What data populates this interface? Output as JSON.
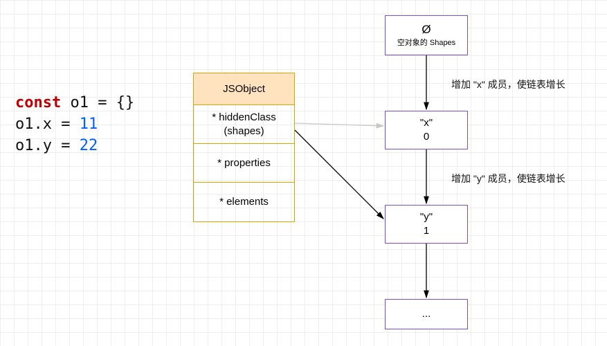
{
  "code": {
    "line1_kw": "const",
    "line1_rest": " o1 = {}",
    "line2_pre": "o1.x = ",
    "line2_num": "11",
    "line3_pre": "o1.y = ",
    "line3_num": "22"
  },
  "jsobject": {
    "header": "JSObject",
    "hiddenClass_l1": "* hiddenClass",
    "hiddenClass_l2": "(shapes)",
    "properties": "* properties",
    "elements": "* elements"
  },
  "shapes": {
    "empty_symbol": "Ø",
    "empty_caption": "空对象的 Shapes",
    "x_label": "\"x\"",
    "x_index": "0",
    "y_label": "\"y\"",
    "y_index": "1",
    "dots": "..."
  },
  "annotations": {
    "add_x": "增加 \"x\" 成员，使链表增长",
    "add_y": "增加 \"y\" 成员，使链表增长"
  }
}
